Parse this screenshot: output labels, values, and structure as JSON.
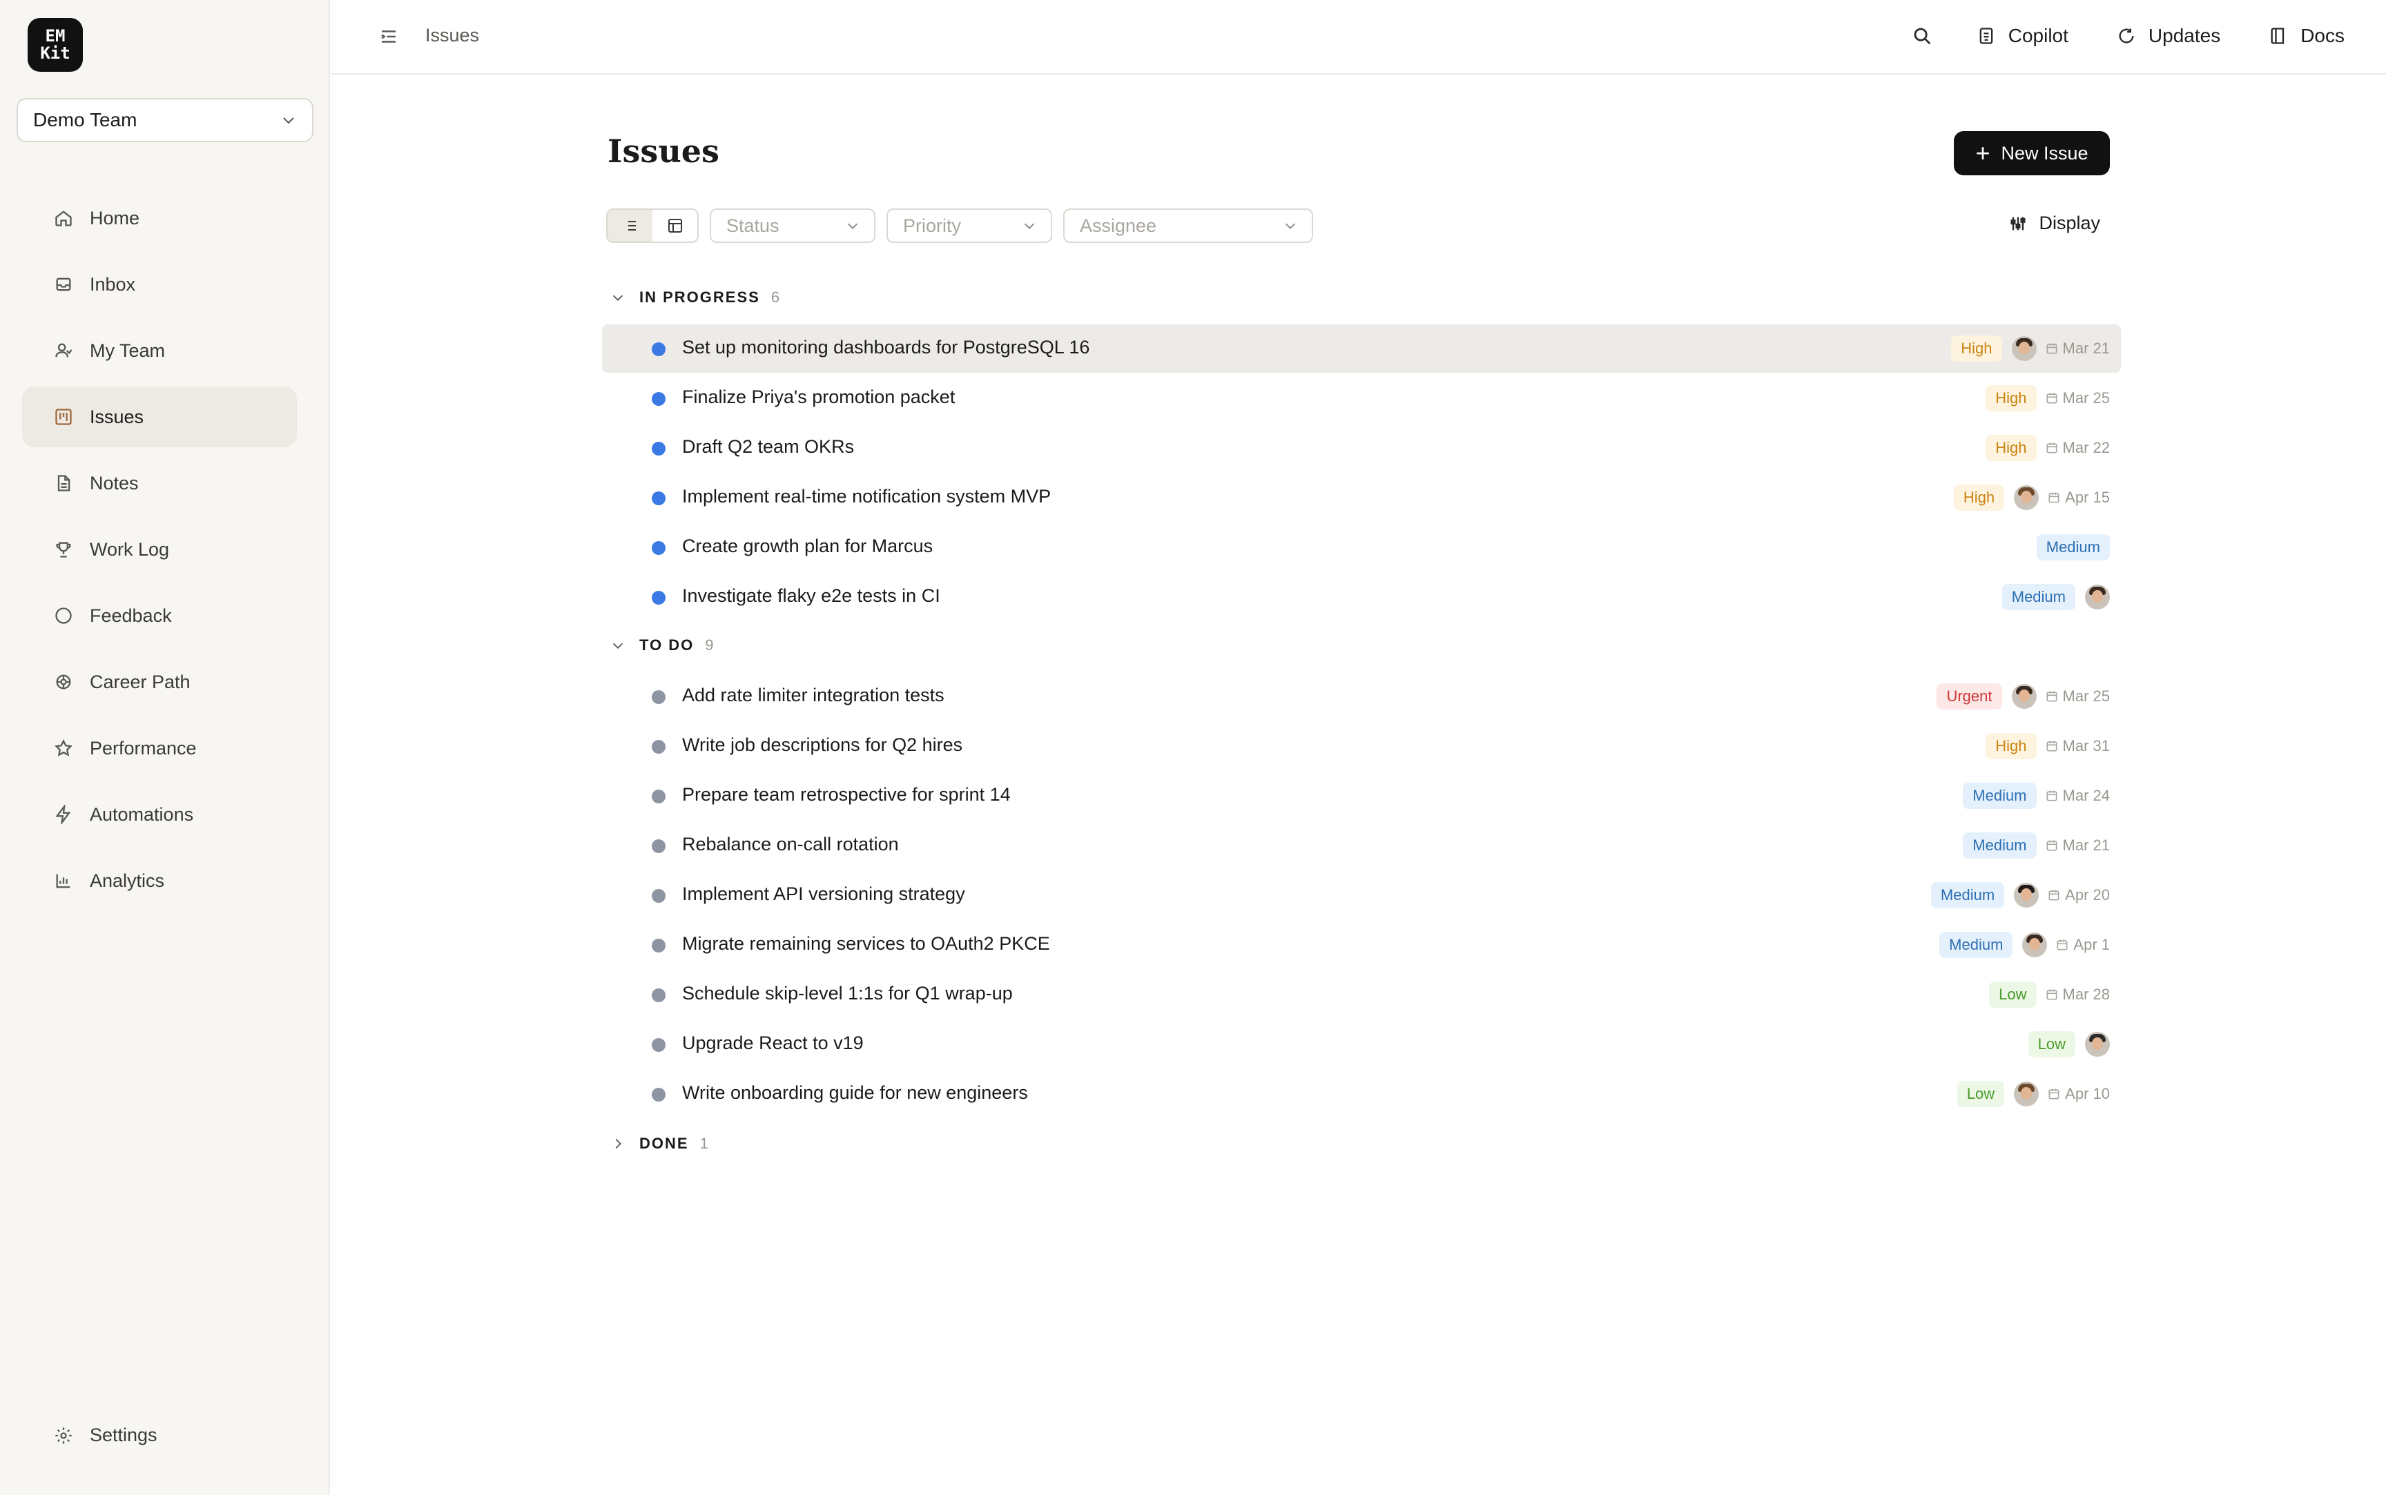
{
  "logo": {
    "line1": "EM",
    "line2": "Kit"
  },
  "team_select": {
    "value": "Demo Team"
  },
  "nav": [
    {
      "label": "Home",
      "icon": "home-icon"
    },
    {
      "label": "Inbox",
      "icon": "inbox-icon"
    },
    {
      "label": "My Team",
      "icon": "users-icon"
    },
    {
      "label": "Issues",
      "icon": "kanban-icon",
      "active": true
    },
    {
      "label": "Notes",
      "icon": "file-icon"
    },
    {
      "label": "Work Log",
      "icon": "trophy-icon"
    },
    {
      "label": "Feedback",
      "icon": "message-icon"
    },
    {
      "label": "Career Path",
      "icon": "ship-icon"
    },
    {
      "label": "Performance",
      "icon": "star-icon"
    },
    {
      "label": "Automations",
      "icon": "zap-icon"
    },
    {
      "label": "Analytics",
      "icon": "bar-chart-icon"
    }
  ],
  "settings": {
    "label": "Settings"
  },
  "topbar": {
    "breadcrumb": "Issues",
    "copilot": "Copilot",
    "updates": "Updates",
    "docs": "Docs"
  },
  "page": {
    "title": "Issues",
    "new_issue": "New Issue"
  },
  "filters": {
    "status": "Status",
    "priority": "Priority",
    "assignee": "Assignee",
    "display": "Display"
  },
  "groups": {
    "in_progress": {
      "label": "IN PROGRESS",
      "count": "6"
    },
    "todo": {
      "label": "TO DO",
      "count": "9"
    },
    "done": {
      "label": "DONE",
      "count": "1"
    }
  },
  "colors": {
    "accent": "#111111",
    "in_progress_dot": "#3b7ae5",
    "todo_dot": "#8e95a2",
    "sidebar_bg": "#f7f6f3"
  },
  "issues_in_progress": [
    {
      "title": "Set up monitoring dashboards for PostgreSQL 16",
      "priority": "High",
      "avatar": true,
      "date": "Mar 21",
      "highlighted": true
    },
    {
      "title": "Finalize Priya's promotion packet",
      "priority": "High",
      "avatar": false,
      "date": "Mar 25"
    },
    {
      "title": "Draft Q2 team OKRs",
      "priority": "High",
      "avatar": false,
      "date": "Mar 22"
    },
    {
      "title": "Implement real-time notification system MVP",
      "priority": "High",
      "avatar": true,
      "date": "Apr 15"
    },
    {
      "title": "Create growth plan for Marcus",
      "priority": "Medium",
      "avatar": false,
      "date": ""
    },
    {
      "title": "Investigate flaky e2e tests in CI",
      "priority": "Medium",
      "avatar": true,
      "date": ""
    }
  ],
  "issues_todo": [
    {
      "title": "Add rate limiter integration tests",
      "priority": "Urgent",
      "avatar": true,
      "date": "Mar 25"
    },
    {
      "title": "Write job descriptions for Q2 hires",
      "priority": "High",
      "avatar": false,
      "date": "Mar 31"
    },
    {
      "title": "Prepare team retrospective for sprint 14",
      "priority": "Medium",
      "avatar": false,
      "date": "Mar 24"
    },
    {
      "title": "Rebalance on-call rotation",
      "priority": "Medium",
      "avatar": false,
      "date": "Mar 21"
    },
    {
      "title": "Implement API versioning strategy",
      "priority": "Medium",
      "avatar": true,
      "date": "Apr 20"
    },
    {
      "title": "Migrate remaining services to OAuth2 PKCE",
      "priority": "Medium",
      "avatar": true,
      "date": "Apr 1"
    },
    {
      "title": "Schedule skip-level 1:1s for Q1 wrap-up",
      "priority": "Low",
      "avatar": false,
      "date": "Mar 28"
    },
    {
      "title": "Upgrade React to v19",
      "priority": "Low",
      "avatar": true,
      "date": ""
    },
    {
      "title": "Write onboarding guide for new engineers",
      "priority": "Low",
      "avatar": true,
      "date": "Apr 10"
    }
  ]
}
